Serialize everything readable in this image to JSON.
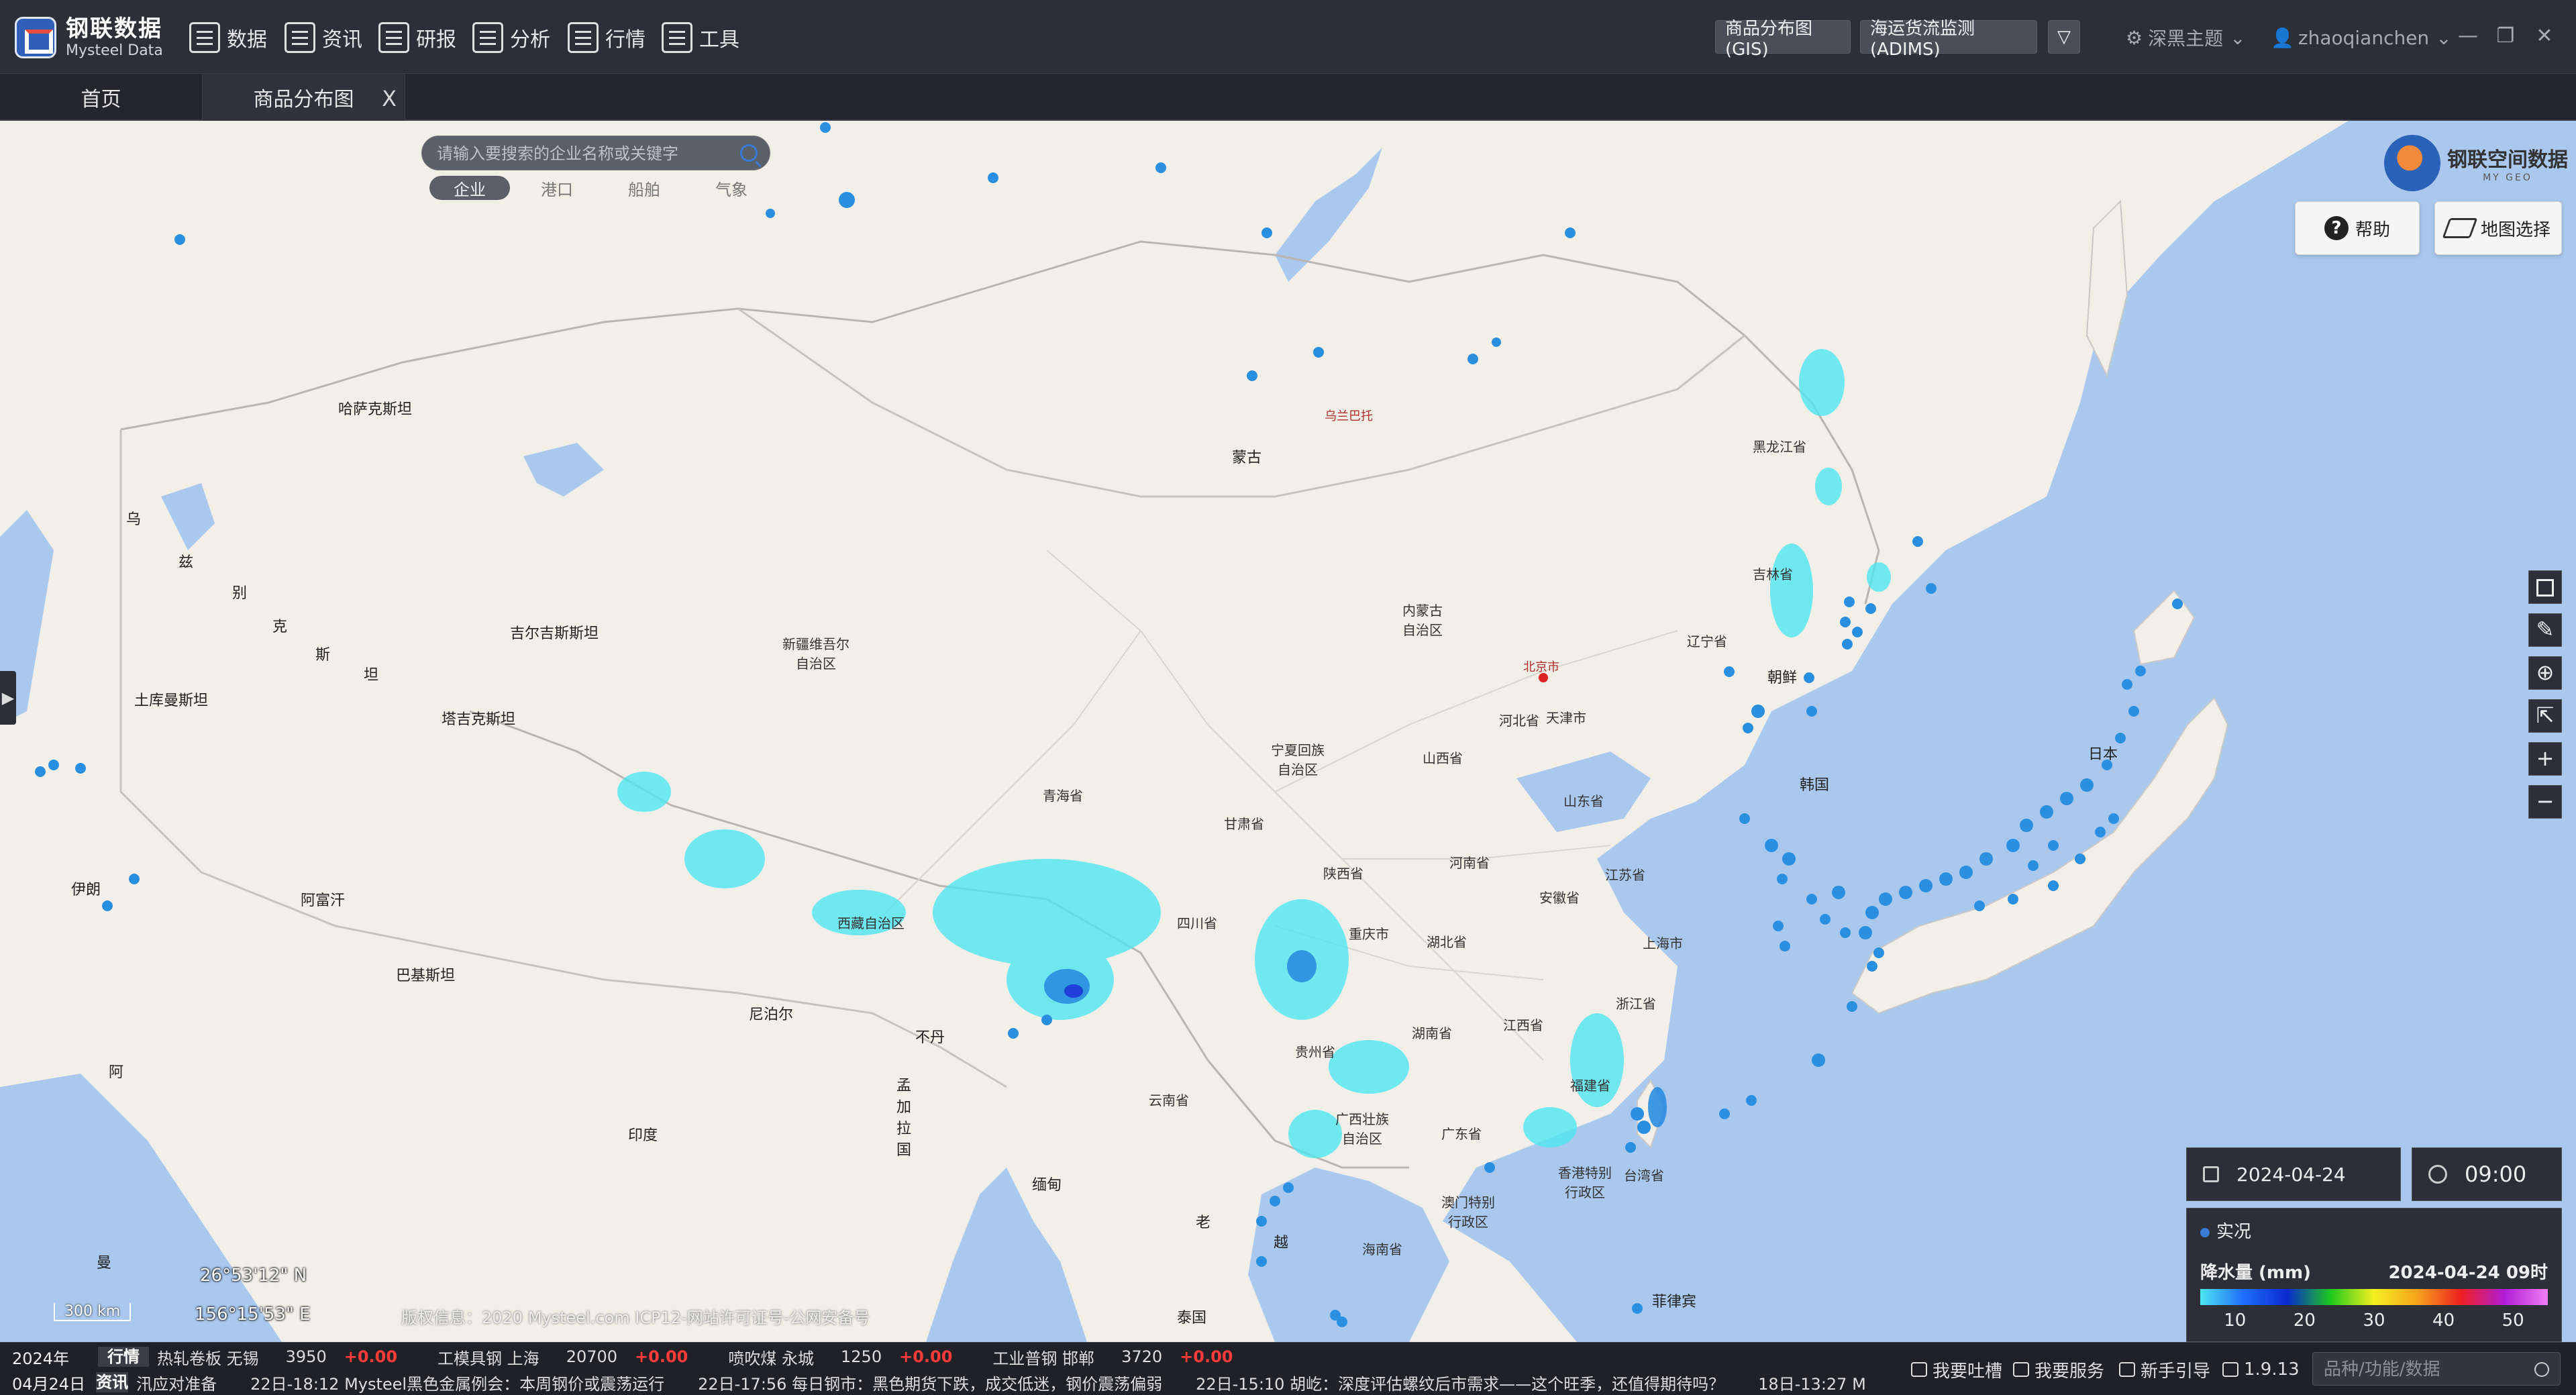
{
  "app": {
    "logo_cn": "钢联数据",
    "logo_en": "Mysteel Data"
  },
  "nav": [
    {
      "label": "数据",
      "icon": "bar-chart-icon"
    },
    {
      "label": "资讯",
      "icon": "news-icon"
    },
    {
      "label": "研报",
      "icon": "report-icon"
    },
    {
      "label": "分析",
      "icon": "analysis-icon"
    },
    {
      "label": "行情",
      "icon": "market-icon"
    },
    {
      "label": "工具",
      "icon": "toolbox-icon"
    }
  ],
  "header_buttons": {
    "gis": "商品分布图(GIS)",
    "adims": "海运货流监测(ADIMS)",
    "dropdown": "▽"
  },
  "header_right": {
    "theme": "深黑主题",
    "user": "zhaoqianchen"
  },
  "tabs": [
    {
      "label": "首页"
    },
    {
      "label": "商品分布图",
      "close": "X"
    }
  ],
  "map": {
    "search_placeholder": "请输入要搜索的企业名称或关键字",
    "categories": [
      "企业",
      "港口",
      "船舶",
      "气象"
    ],
    "brand_name": "钢联空间数据",
    "brand_sub": "MY GEO",
    "help_label": "帮助",
    "layer_label": "地图选择",
    "date": "2024-04-24",
    "time": "09:00",
    "legend": {
      "title": "实况",
      "metric": "降水量 (mm)",
      "timestamp": "2024-04-24 09时",
      "ticks": [
        "10",
        "20",
        "30",
        "40",
        "50"
      ]
    },
    "scale": "300 km",
    "coord_lat": "26°53'12\" N",
    "coord_lon": "156°15'53\" E",
    "copyright": "版权信息：2020 Mysteel.com  ICP12-网站许可证号-公网安备号",
    "labels": {
      "kazakhstan": "哈萨克斯坦",
      "mongolia": "蒙古",
      "ulaanbaatar": "乌兰巴托",
      "heilongjiang": "黑龙江省",
      "jilin": "吉林省",
      "liaoning": "辽宁省",
      "neimenggu": "内蒙古\n自治区",
      "xinjiang": "新疆维吾尔\n自治区",
      "kyrgyzstan": "吉尔吉斯斯坦",
      "tajikistan": "塔吉克斯坦",
      "turkmenistan": "土库曼斯坦",
      "afghanistan": "阿富汗",
      "pakistan": "巴基斯坦",
      "iran": "伊朗",
      "india": "印度",
      "nepal": "尼泊尔",
      "bhutan": "不丹",
      "bangladesh": "孟加拉国",
      "myanmar": "缅甸",
      "laos": "老",
      "vietnam": "越",
      "thailand": "泰国",
      "philippines": "菲律宾",
      "japan": "日本",
      "north_korea": "朝鲜",
      "south_korea": "韩国",
      "beijing": "北京市",
      "tianjin": "天津市",
      "hebei": "河北省",
      "shanxi": "山西省",
      "shandong": "山东省",
      "henan": "河南省",
      "jiangsu": "江苏省",
      "shanghai": "上海市",
      "anhui": "安徽省",
      "zhejiang": "浙江省",
      "hubei": "湖北省",
      "hunan": "湖南省",
      "jiangxi": "江西省",
      "fujian": "福建省",
      "guangdong": "广东省",
      "guangxi": "广西壮族\n自治区",
      "guizhou": "贵州省",
      "yunnan": "云南省",
      "sichuan": "四川省",
      "chongqing": "重庆市",
      "shaanxi": "陕西省",
      "gansu": "甘肃省",
      "ningxia": "宁夏回族\n自治区",
      "qinghai": "青海省",
      "tibet": "西藏自治区",
      "taiwan": "台湾省",
      "hainan": "海南省",
      "hongkong": "香港特别\n行政区",
      "macau": "澳门特别\n行政区",
      "wu": "乌",
      "zi": "兹",
      "bie": "别",
      "ke": "克",
      "si": "斯",
      "tan": "坦",
      "a": "阿",
      "man": "曼"
    }
  },
  "bottom": {
    "row1_date": "2024年",
    "row1_tag": "行情",
    "tickers": [
      {
        "name": "热轧卷板 无锡",
        "price": "3950",
        "change": "+0.00"
      },
      {
        "name": "工模具钢 上海",
        "price": "20700",
        "change": "+0.00"
      },
      {
        "name": "喷吹煤 永城",
        "price": "1250",
        "change": "+0.00"
      },
      {
        "name": "工业普钢 邯郸",
        "price": "3720",
        "change": "+0.00"
      }
    ],
    "row2_date": "04月24日",
    "row2_tag": "资讯",
    "news": [
      "汛应对准备",
      "22日-18:12  Mysteel黑色金属例会：本周钢价或震荡运行",
      "22日-17:56  每日钢市：黑色期货下跌，成交低迷，钢价震荡偏弱",
      "22日-15:10  胡屹：深度评估螺纹后市需求——这个旺季，还值得期待吗？",
      "18日-13:27  M"
    ],
    "actions": [
      "我要吐槽",
      "我要服务",
      "新手引导",
      "1.9.13"
    ],
    "search_placeholder": "品种/功能/数据"
  }
}
